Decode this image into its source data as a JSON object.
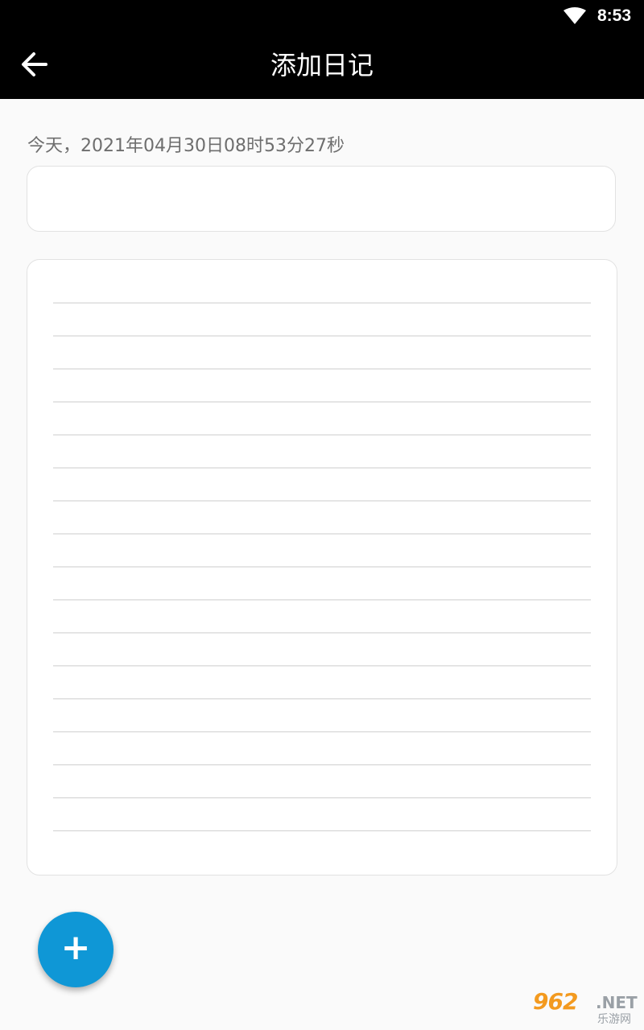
{
  "status_bar": {
    "time": "8:53",
    "icons": [
      "wifi-icon"
    ]
  },
  "toolbar": {
    "back_icon": "arrow-left-icon",
    "title": "添加日记"
  },
  "form": {
    "date_label": "今天，2021年04月30日08时53分27秒",
    "title_value": "",
    "content_value": ""
  },
  "fab": {
    "icon": "plus-icon",
    "label": "+",
    "color": "#0f97d6"
  },
  "watermark": {
    "brand": "962",
    "suffix": ".NET",
    "subtitle": "乐游网"
  },
  "colors": {
    "bar_background": "#000000",
    "page_background": "#fafafa",
    "accent": "#0f97d6"
  }
}
